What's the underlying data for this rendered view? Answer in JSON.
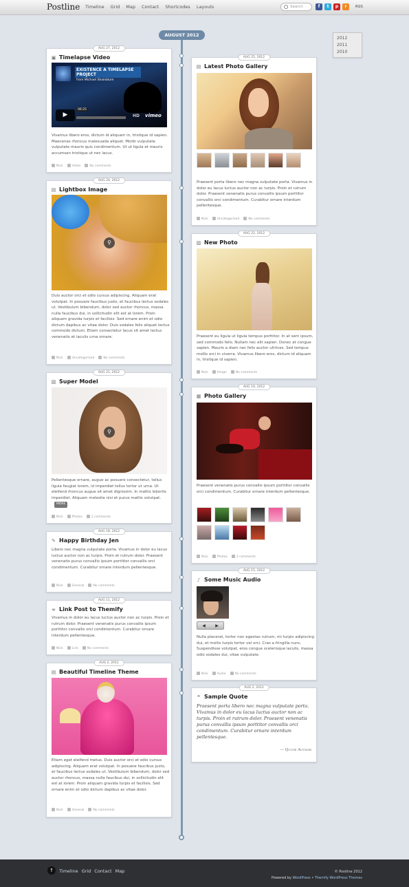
{
  "site": {
    "logo": "Postline"
  },
  "nav": [
    "Timeline",
    "Grid",
    "Map",
    "Contact",
    "Shortcodes",
    "Layouts"
  ],
  "search": {
    "placeholder": "Search"
  },
  "social": [
    {
      "name": "facebook-icon",
      "glyph": "f",
      "color": "#3b5998"
    },
    {
      "name": "twitter-icon",
      "glyph": "t",
      "color": "#33aadd"
    },
    {
      "name": "pinterest-icon",
      "glyph": "p",
      "color": "#cb2027"
    },
    {
      "name": "rss-icon",
      "glyph": "r",
      "color": "#f08a24"
    }
  ],
  "rss_label": "RSS",
  "month": "AUGUST 2012",
  "years": [
    "2012",
    "2011",
    "2010"
  ],
  "video_player": {
    "title": "EXISTENCE A TIMELAPSE PROJECT",
    "by": "from Michael Shainblum",
    "time": "06:25",
    "brand": "vimeo",
    "hd": "HD"
  },
  "posts": {
    "timelapse": {
      "date": "AUG 27, 2012",
      "title": "Timelapse Video",
      "excerpt": "Vivamus libero eros, dictum id aliquam in, tristique id sapien. Maecenas rhoncus malesuada aliquet. Morbi vulputate vulputate mauris quis condimentum. Ut ut ligula et mauris accumsan tristique ut nec lacus.",
      "author": "Nick",
      "category": "Video",
      "comments": "No comments"
    },
    "gallery": {
      "date": "AUG 25, 2012",
      "title": "Latest Photo Gallery",
      "excerpt": "Praesent porta libero nec magna vulputate porta. Vivamus in dolor eu lacus luctus auctor non ac turpis. Proin et rutrum dolor. Praesent venenatis purus convallis ipsum porttitor convallis orci condimentum. Curabitur ornare interdum pellentesque.",
      "author": "Nick",
      "category": "Uncategorized",
      "comments": "No comments"
    },
    "lightbox": {
      "date": "AUG 24, 2012",
      "title": "Lightbox Image",
      "excerpt": "Duis auctor orci et odio cursus adipiscing. Aliquam erat volutpat. In posuere faucibus justo, et faucibus lectus sodales ut. Vestibulum bibendum, dolor sed auctor rhoncus, massa nulla faucibus dui, in sollicitudin elit est at lorem. Proin aliquam gravida turpis et facilisis. Sed ornare enim et odio dictum dapibus ac vitae dolor. Duis sodales felis aliquet lectus commodo dictum. Etiam consectetur lacus sit amet lectus venenatis et iaculis urna ornare.",
      "author": "Nick",
      "category": "Uncategorized",
      "comments": "No comments"
    },
    "newphoto": {
      "date": "AUG 22, 2012",
      "title": "New Photo",
      "excerpt": "Praesent eu ligula ut ligula tempus porttitor. In at sem ipsum, sed commodo felis. Nullam nec elit sapien. Donec at congue sapien. Mauris a diam nec felis auctor ultrices. Sed tempus mollis orci in viverra. Vivamus libero eros, dictum id aliquam in, tristique id sapien.",
      "author": "Nick",
      "category": "Image",
      "comments": "No comments"
    },
    "supermodel": {
      "date": "AUG 21, 2012",
      "title": "Super Model",
      "excerpt": "Pellentesque ornare, augue ac posuere consectetur, tellus ligula feugiat lorem, id imperdiet tellus tortor ut urna. Ut eleifend rhoncus augue sit amet dignissim. In mattis lobortis imperdiet. Aliquam molestie nisi et purus mattis volutpat.",
      "more": "MORE",
      "author": "Nick",
      "category": "Photos",
      "comments": "2 comments"
    },
    "photogallery": {
      "date": "AUG 19, 2012",
      "title": "Photo Gallery",
      "excerpt": "Praesent venenatis purus convallis ipsum porttitor convallis orci condimentum. Curabitur ornare interdum pellentesque.",
      "author": "Nick",
      "category": "Photos",
      "comments": "2 comments"
    },
    "birthday": {
      "date": "AUG 18, 2012",
      "title": "Happy Birthday Jen",
      "excerpt": "Libero nec magna vulputate porta. Vivamus in dolor eu lacus luctus auctor non ac turpis. Proin et rutrum dolor. Praesent venenatis purus convallis ipsum porttitor convallis orci condimentum. Curabitur ornare interdum pellentesque.",
      "author": "Nick",
      "category": "General",
      "comments": "No comments"
    },
    "music": {
      "date": "AUG 15, 2012",
      "title": "Some Music Audio",
      "excerpt": "Nulla placerat, tortor non egestas rutrum, mi turpis adipiscing dui, et mollis turpis tortor vel orci. Cras a fringilla nunc. Suspendisse volutpat, eros congue scelerisque iaculis, massa odio sodales dui, vitae vulputate.",
      "author": "Nick",
      "category": "Audio",
      "comments": "No comments"
    },
    "link": {
      "date": "AUG 11, 2012",
      "title": "Link Post to Themify",
      "excerpt": "Vivamus in dolor eu lacus luctus auctor non ac turpis. Proin et rutrum dolor. Praesent venenatis purus convallis ipsum porttitor convallis orci condimentum. Curabitur ornare interdum pellentesque.",
      "author": "Nick",
      "category": "Link",
      "comments": "No comments"
    },
    "quote": {
      "date": "AUG 2, 2012",
      "title": "Sample Quote",
      "excerpt": "Praesent porta libero nec magna vulputate porta. Vivamus in dolor eu lacus luctus auctor non ac turpis. Proin et rutrum dolor. Praesent venenatis purus convallis ipsum porttitor convallis orci condimentum. Curabitur ornare interdum pellentesque.",
      "author_line": "— Quote Author"
    },
    "theme": {
      "date": "AUG 2, 2012",
      "title": "Beautiful Timeline Theme",
      "excerpt": "Etiam eget eleifend metus. Duis auctor orci et odio cursus adipiscing. Aliquam erat volutpat. In posuere faucibus justo, et faucibus lectus sodales ut. Vestibulum bibendum, dolor sed auctor rhoncus, massa nulla faucibus dui, in sollicitudin elit est at lorem. Proin aliquam gravida turpis et facilisis. Sed ornare enim et odio dictum dapibus ac vitae dolor.",
      "author": "Nick",
      "category": "General",
      "comments": "No comments"
    }
  },
  "footer": {
    "nav": [
      "Timeline",
      "Grid",
      "Contact",
      "Map"
    ],
    "copyright": "© Postline 2012",
    "powered_prefix": "Powered by",
    "wordpress": "WordPress",
    "bullet": "•",
    "themify": "Themify WordPress Themes"
  }
}
